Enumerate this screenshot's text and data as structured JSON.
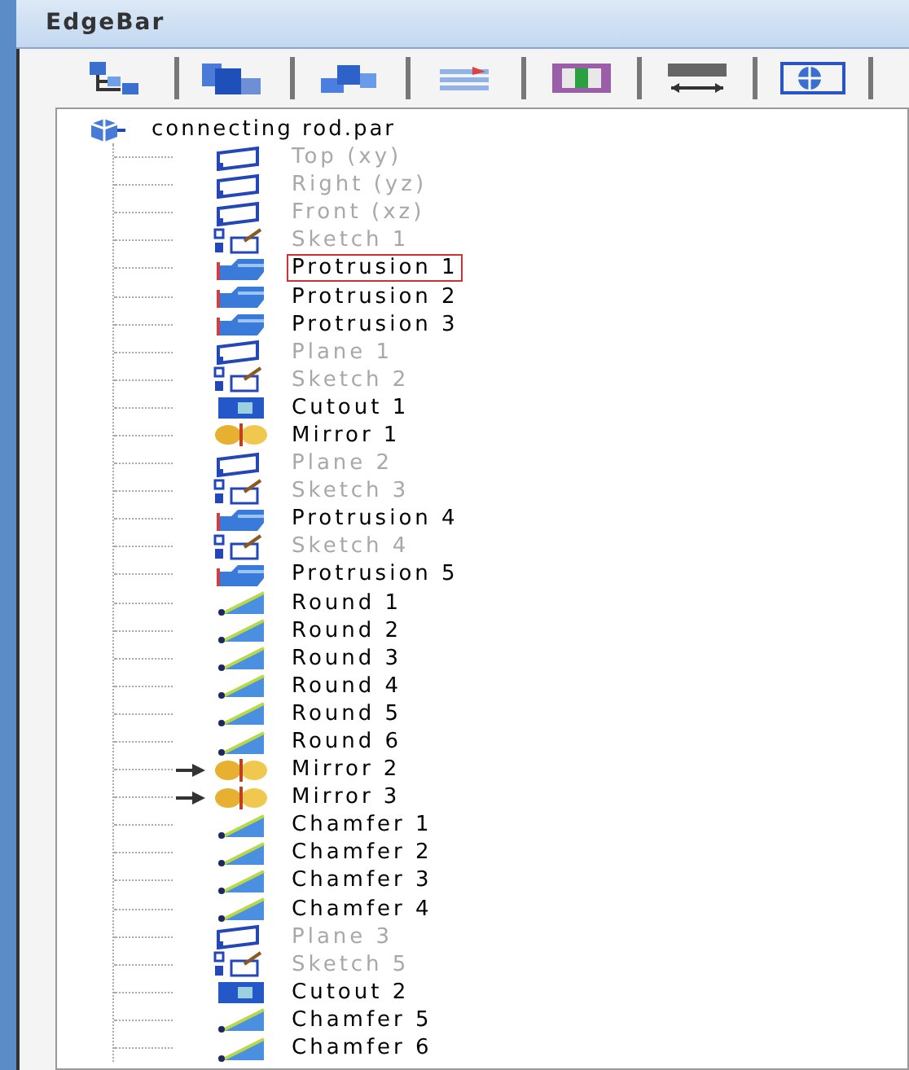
{
  "window": {
    "title": "EdgeBar"
  },
  "toolbar": [
    {
      "kind": "tree"
    },
    {
      "kind": "assembly"
    },
    {
      "kind": "parts"
    },
    {
      "kind": "layers"
    },
    {
      "kind": "colors"
    },
    {
      "kind": "dimensions"
    },
    {
      "kind": "library"
    }
  ],
  "tree": {
    "root": {
      "label": "connecting rod.par",
      "children": [
        {
          "label": "Top (xy)",
          "kind": "plane",
          "dimmed": true,
          "selected": false,
          "pointer": false
        },
        {
          "label": "Right (yz)",
          "kind": "plane",
          "dimmed": true,
          "selected": false,
          "pointer": false
        },
        {
          "label": "Front (xz)",
          "kind": "plane",
          "dimmed": true,
          "selected": false,
          "pointer": false
        },
        {
          "label": "Sketch 1",
          "kind": "sketch",
          "dimmed": true,
          "selected": false,
          "pointer": false
        },
        {
          "label": "Protrusion 1",
          "kind": "protrusion",
          "dimmed": false,
          "selected": true,
          "pointer": false
        },
        {
          "label": "Protrusion 2",
          "kind": "protrusion",
          "dimmed": false,
          "selected": false,
          "pointer": false
        },
        {
          "label": "Protrusion 3",
          "kind": "protrusion",
          "dimmed": false,
          "selected": false,
          "pointer": false
        },
        {
          "label": "Plane 1",
          "kind": "plane",
          "dimmed": true,
          "selected": false,
          "pointer": false
        },
        {
          "label": "Sketch 2",
          "kind": "sketch",
          "dimmed": true,
          "selected": false,
          "pointer": false
        },
        {
          "label": "Cutout 1",
          "kind": "cutout",
          "dimmed": false,
          "selected": false,
          "pointer": false
        },
        {
          "label": "Mirror 1",
          "kind": "mirror",
          "dimmed": false,
          "selected": false,
          "pointer": false
        },
        {
          "label": "Plane 2",
          "kind": "plane",
          "dimmed": true,
          "selected": false,
          "pointer": false
        },
        {
          "label": "Sketch 3",
          "kind": "sketch",
          "dimmed": true,
          "selected": false,
          "pointer": false
        },
        {
          "label": "Protrusion 4",
          "kind": "protrusion",
          "dimmed": false,
          "selected": false,
          "pointer": false
        },
        {
          "label": "Sketch 4",
          "kind": "sketch",
          "dimmed": true,
          "selected": false,
          "pointer": false
        },
        {
          "label": "Protrusion 5",
          "kind": "protrusion",
          "dimmed": false,
          "selected": false,
          "pointer": false
        },
        {
          "label": "Round 1",
          "kind": "round",
          "dimmed": false,
          "selected": false,
          "pointer": false
        },
        {
          "label": "Round 2",
          "kind": "round",
          "dimmed": false,
          "selected": false,
          "pointer": false
        },
        {
          "label": "Round 3",
          "kind": "round",
          "dimmed": false,
          "selected": false,
          "pointer": false
        },
        {
          "label": "Round 4",
          "kind": "round",
          "dimmed": false,
          "selected": false,
          "pointer": false
        },
        {
          "label": "Round 5",
          "kind": "round",
          "dimmed": false,
          "selected": false,
          "pointer": false
        },
        {
          "label": "Round 6",
          "kind": "round",
          "dimmed": false,
          "selected": false,
          "pointer": false
        },
        {
          "label": "Mirror 2",
          "kind": "mirror",
          "dimmed": false,
          "selected": false,
          "pointer": true
        },
        {
          "label": "Mirror 3",
          "kind": "mirror",
          "dimmed": false,
          "selected": false,
          "pointer": true
        },
        {
          "label": "Chamfer 1",
          "kind": "round",
          "dimmed": false,
          "selected": false,
          "pointer": false
        },
        {
          "label": "Chamfer 2",
          "kind": "round",
          "dimmed": false,
          "selected": false,
          "pointer": false
        },
        {
          "label": "Chamfer 3",
          "kind": "round",
          "dimmed": false,
          "selected": false,
          "pointer": false
        },
        {
          "label": "Chamfer 4",
          "kind": "round",
          "dimmed": false,
          "selected": false,
          "pointer": false
        },
        {
          "label": "Plane 3",
          "kind": "plane",
          "dimmed": true,
          "selected": false,
          "pointer": false
        },
        {
          "label": "Sketch 5",
          "kind": "sketch",
          "dimmed": true,
          "selected": false,
          "pointer": false
        },
        {
          "label": "Cutout 2",
          "kind": "cutout",
          "dimmed": false,
          "selected": false,
          "pointer": false
        },
        {
          "label": "Chamfer 5",
          "kind": "round",
          "dimmed": false,
          "selected": false,
          "pointer": false
        },
        {
          "label": "Chamfer 6",
          "kind": "round",
          "dimmed": false,
          "selected": false,
          "pointer": false
        }
      ]
    }
  }
}
